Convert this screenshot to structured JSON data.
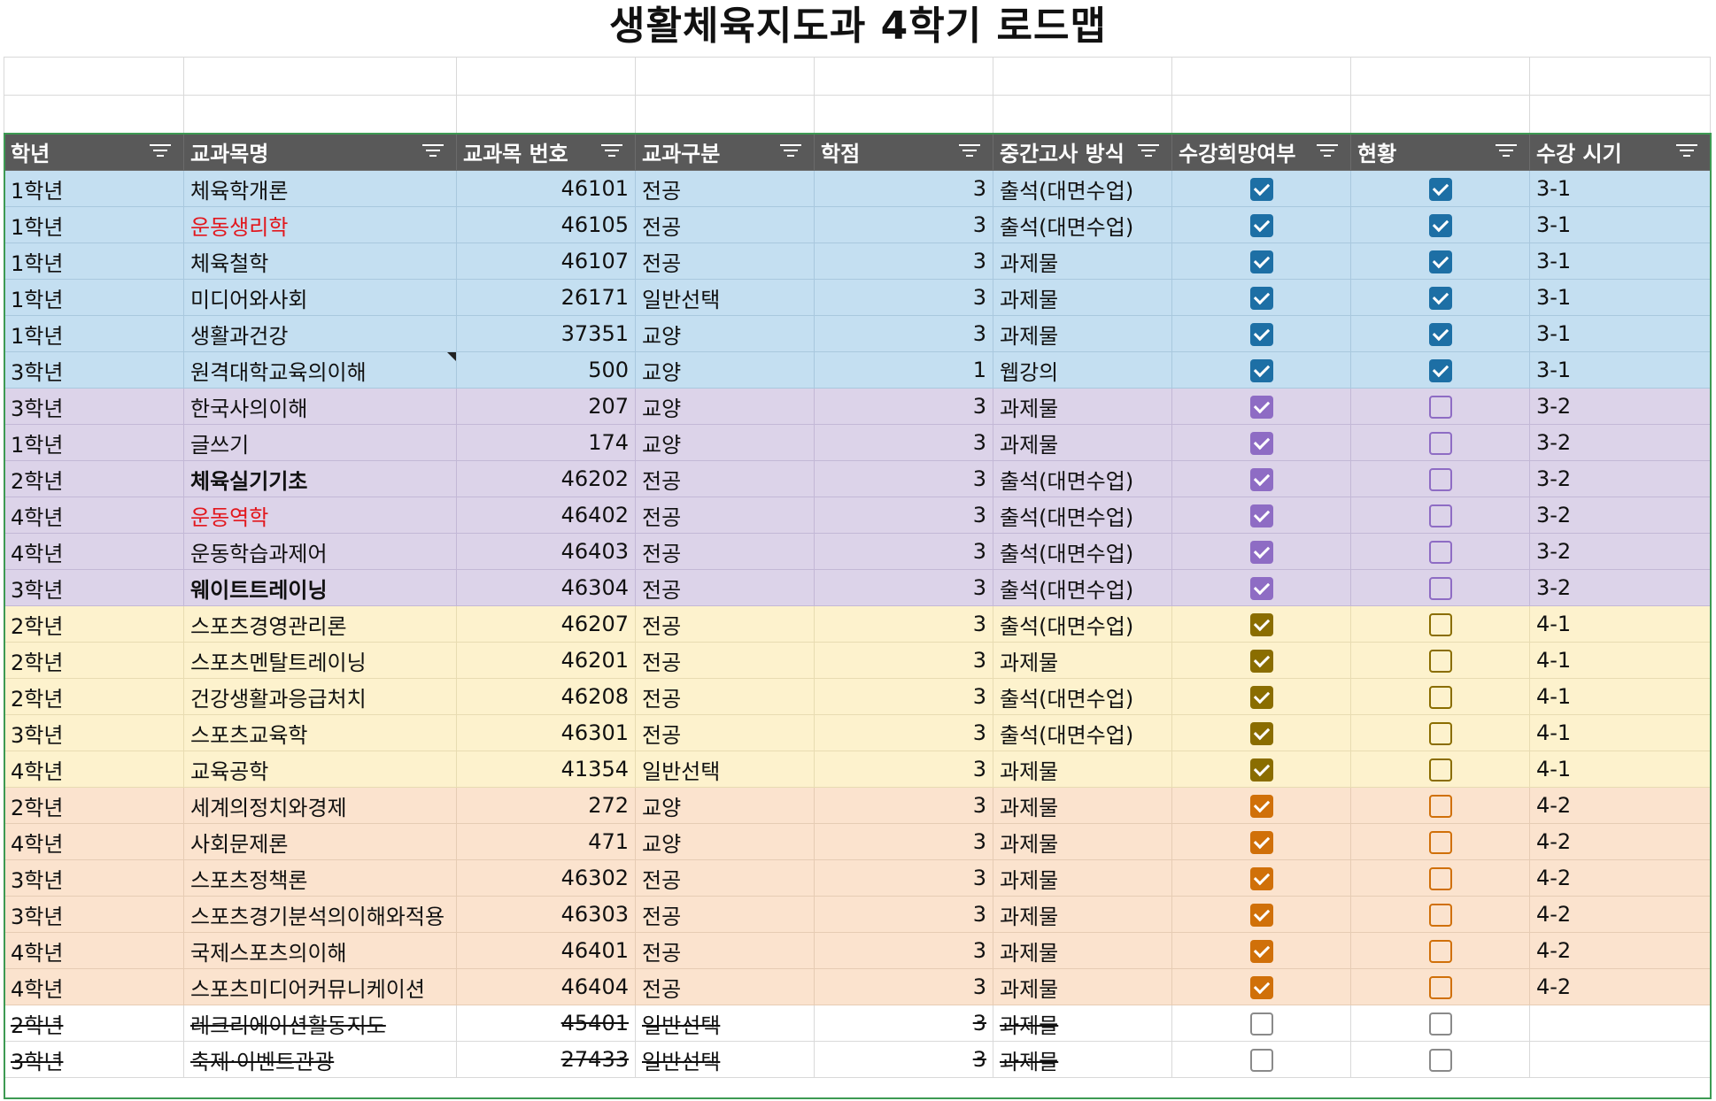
{
  "title": "생활체육지도과 4학기 로드맵",
  "headers": [
    "학년",
    "교과목명",
    "교과목 번호",
    "교과구분",
    "학점",
    "중간고사 방식",
    "수강희망여부",
    "현황",
    "수강 시기"
  ],
  "group_colors": {
    "blue": {
      "fill": "#1d6fa5",
      "empty": "#1d6fa5"
    },
    "purple": {
      "fill": "#8e6cc4",
      "empty": "#8e6cc4"
    },
    "yellow": {
      "fill": "#8a6d00",
      "empty": "#8a6d00"
    },
    "orange": {
      "fill": "#d07009",
      "empty": "#d07009"
    },
    "none": {
      "fill": "#777777",
      "empty": "#8a8a8a"
    }
  },
  "rows": [
    {
      "grade": "1학년",
      "course": "체육학개론",
      "code": "46101",
      "category": "전공",
      "credits": "3",
      "exam": "출석(대면수업)",
      "want": true,
      "status": true,
      "term": "3-1",
      "group": "blue"
    },
    {
      "grade": "1학년",
      "course": "운동생리학",
      "code": "46105",
      "category": "전공",
      "credits": "3",
      "exam": "출석(대면수업)",
      "want": true,
      "status": true,
      "term": "3-1",
      "group": "blue",
      "style": "red"
    },
    {
      "grade": "1학년",
      "course": "체육철학",
      "code": "46107",
      "category": "전공",
      "credits": "3",
      "exam": "과제물",
      "want": true,
      "status": true,
      "term": "3-1",
      "group": "blue"
    },
    {
      "grade": "1학년",
      "course": "미디어와사회",
      "code": "26171",
      "category": "일반선택",
      "credits": "3",
      "exam": "과제물",
      "want": true,
      "status": true,
      "term": "3-1",
      "group": "blue"
    },
    {
      "grade": "1학년",
      "course": "생활과건강",
      "code": "37351",
      "category": "교양",
      "credits": "3",
      "exam": "과제물",
      "want": true,
      "status": true,
      "term": "3-1",
      "group": "blue"
    },
    {
      "grade": "3학년",
      "course": "원격대학교육의이해",
      "code": "500",
      "category": "교양",
      "credits": "1",
      "exam": "웹강의",
      "want": true,
      "status": true,
      "term": "3-1",
      "group": "blue",
      "note": true
    },
    {
      "grade": "3학년",
      "course": "한국사의이해",
      "code": "207",
      "category": "교양",
      "credits": "3",
      "exam": "과제물",
      "want": true,
      "status": false,
      "term": "3-2",
      "group": "purple"
    },
    {
      "grade": "1학년",
      "course": "글쓰기",
      "code": "174",
      "category": "교양",
      "credits": "3",
      "exam": "과제물",
      "want": true,
      "status": false,
      "term": "3-2",
      "group": "purple"
    },
    {
      "grade": "2학년",
      "course": "체육실기기초",
      "code": "46202",
      "category": "전공",
      "credits": "3",
      "exam": "출석(대면수업)",
      "want": true,
      "status": false,
      "term": "3-2",
      "group": "purple",
      "style": "bold"
    },
    {
      "grade": "4학년",
      "course": "운동역학",
      "code": "46402",
      "category": "전공",
      "credits": "3",
      "exam": "출석(대면수업)",
      "want": true,
      "status": false,
      "term": "3-2",
      "group": "purple",
      "style": "red"
    },
    {
      "grade": "4학년",
      "course": "운동학습과제어",
      "code": "46403",
      "category": "전공",
      "credits": "3",
      "exam": "출석(대면수업)",
      "want": true,
      "status": false,
      "term": "3-2",
      "group": "purple"
    },
    {
      "grade": "3학년",
      "course": "웨이트트레이닝",
      "code": "46304",
      "category": "전공",
      "credits": "3",
      "exam": "출석(대면수업)",
      "want": true,
      "status": false,
      "term": "3-2",
      "group": "purple",
      "style": "bold"
    },
    {
      "grade": "2학년",
      "course": "스포츠경영관리론",
      "code": "46207",
      "category": "전공",
      "credits": "3",
      "exam": "출석(대면수업)",
      "want": true,
      "status": false,
      "term": "4-1",
      "group": "yellow"
    },
    {
      "grade": "2학년",
      "course": "스포츠멘탈트레이닝",
      "code": "46201",
      "category": "전공",
      "credits": "3",
      "exam": "과제물",
      "want": true,
      "status": false,
      "term": "4-1",
      "group": "yellow"
    },
    {
      "grade": "2학년",
      "course": "건강생활과응급처치",
      "code": "46208",
      "category": "전공",
      "credits": "3",
      "exam": "출석(대면수업)",
      "want": true,
      "status": false,
      "term": "4-1",
      "group": "yellow"
    },
    {
      "grade": "3학년",
      "course": "스포츠교육학",
      "code": "46301",
      "category": "전공",
      "credits": "3",
      "exam": "출석(대면수업)",
      "want": true,
      "status": false,
      "term": "4-1",
      "group": "yellow"
    },
    {
      "grade": "4학년",
      "course": "교육공학",
      "code": "41354",
      "category": "일반선택",
      "credits": "3",
      "exam": "과제물",
      "want": true,
      "status": false,
      "term": "4-1",
      "group": "yellow"
    },
    {
      "grade": "2학년",
      "course": "세계의정치와경제",
      "code": "272",
      "category": "교양",
      "credits": "3",
      "exam": "과제물",
      "want": true,
      "status": false,
      "term": "4-2",
      "group": "orange"
    },
    {
      "grade": "4학년",
      "course": "사회문제론",
      "code": "471",
      "category": "교양",
      "credits": "3",
      "exam": "과제물",
      "want": true,
      "status": false,
      "term": "4-2",
      "group": "orange"
    },
    {
      "grade": "3학년",
      "course": "스포츠정책론",
      "code": "46302",
      "category": "전공",
      "credits": "3",
      "exam": "과제물",
      "want": true,
      "status": false,
      "term": "4-2",
      "group": "orange"
    },
    {
      "grade": "3학년",
      "course": "스포츠경기분석의이해와적용",
      "code": "46303",
      "category": "전공",
      "credits": "3",
      "exam": "과제물",
      "want": true,
      "status": false,
      "term": "4-2",
      "group": "orange"
    },
    {
      "grade": "4학년",
      "course": "국제스포츠의이해",
      "code": "46401",
      "category": "전공",
      "credits": "3",
      "exam": "과제물",
      "want": true,
      "status": false,
      "term": "4-2",
      "group": "orange"
    },
    {
      "grade": "4학년",
      "course": "스포츠미디어커뮤니케이션",
      "code": "46404",
      "category": "전공",
      "credits": "3",
      "exam": "과제물",
      "want": true,
      "status": false,
      "term": "4-2",
      "group": "orange"
    },
    {
      "grade": "2학년",
      "course": "레크리에이션활동지도",
      "code": "45401",
      "category": "일반선택",
      "credits": "3",
      "exam": "과제물",
      "want": false,
      "status": false,
      "term": "",
      "group": "none",
      "strike": true
    },
    {
      "grade": "3학년",
      "course": "축제·이벤트관광",
      "code": "27433",
      "category": "일반선택",
      "credits": "3",
      "exam": "과제물",
      "want": false,
      "status": false,
      "term": "",
      "group": "none",
      "strike": true
    }
  ]
}
